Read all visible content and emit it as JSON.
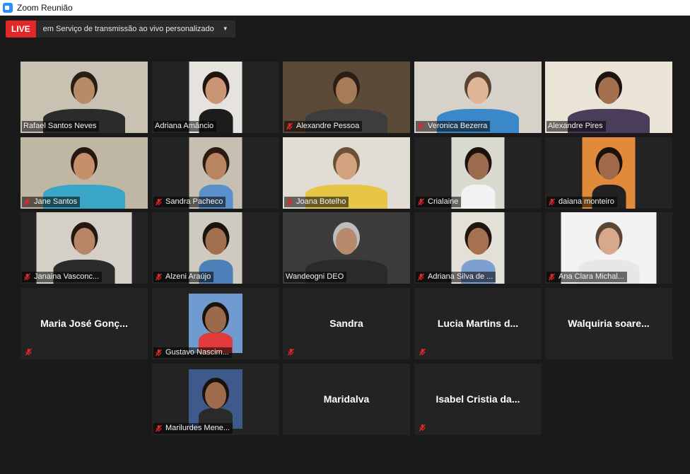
{
  "window": {
    "title": "Zoom Reunião"
  },
  "live": {
    "badge": "LIVE",
    "service": "em Serviço de transmissão ao vivo personalizado"
  },
  "participants": [
    {
      "name": "Rafael Santos Neves",
      "muted": false,
      "video": true
    },
    {
      "name": "Adriana Amâncio",
      "muted": false,
      "video": true
    },
    {
      "name": "Alexandre Pessoa",
      "muted": true,
      "video": true
    },
    {
      "name": "Veronica Bezerra",
      "muted": true,
      "video": true
    },
    {
      "name": "Alexandre Pires",
      "muted": false,
      "video": true,
      "active_speaker": true
    },
    {
      "name": "Jane Santos",
      "muted": true,
      "video": true
    },
    {
      "name": "Sandra Pacheco",
      "muted": true,
      "video": true
    },
    {
      "name": "Joana Botelho",
      "muted": true,
      "video": true
    },
    {
      "name": "Crialaine",
      "muted": true,
      "video": true
    },
    {
      "name": "daiana monteiro",
      "muted": true,
      "video": true
    },
    {
      "name": "Janaina Vasconc...",
      "muted": true,
      "video": true
    },
    {
      "name": "Alzeni Araújo",
      "muted": true,
      "video": true
    },
    {
      "name": "Wandeogni DEO",
      "muted": false,
      "video": true
    },
    {
      "name": "Adriana Silva de ...",
      "muted": true,
      "video": true
    },
    {
      "name": "Ana Clara Michal...",
      "muted": true,
      "video": true
    },
    {
      "name": "Maria José Gonç...",
      "muted": true,
      "video": false
    },
    {
      "name": "Gustavo Nascim...",
      "muted": true,
      "video": true
    },
    {
      "name": "Sandra",
      "muted": true,
      "video": false
    },
    {
      "name": "Lucia Martins d...",
      "muted": true,
      "video": false
    },
    {
      "name": "Walquiria soare...",
      "muted": false,
      "video": false
    },
    {
      "name": "Marilurdes Mene...",
      "muted": true,
      "video": true
    },
    {
      "name": "Maridalva",
      "muted": false,
      "video": false
    },
    {
      "name": "Isabel Cristia da...",
      "muted": true,
      "video": false
    }
  ],
  "colors": {
    "background": "#1a1a1a",
    "tile": "#232323",
    "active_border": "#c3e35a",
    "live_red": "#e02828",
    "mute_red": "#e02828"
  }
}
